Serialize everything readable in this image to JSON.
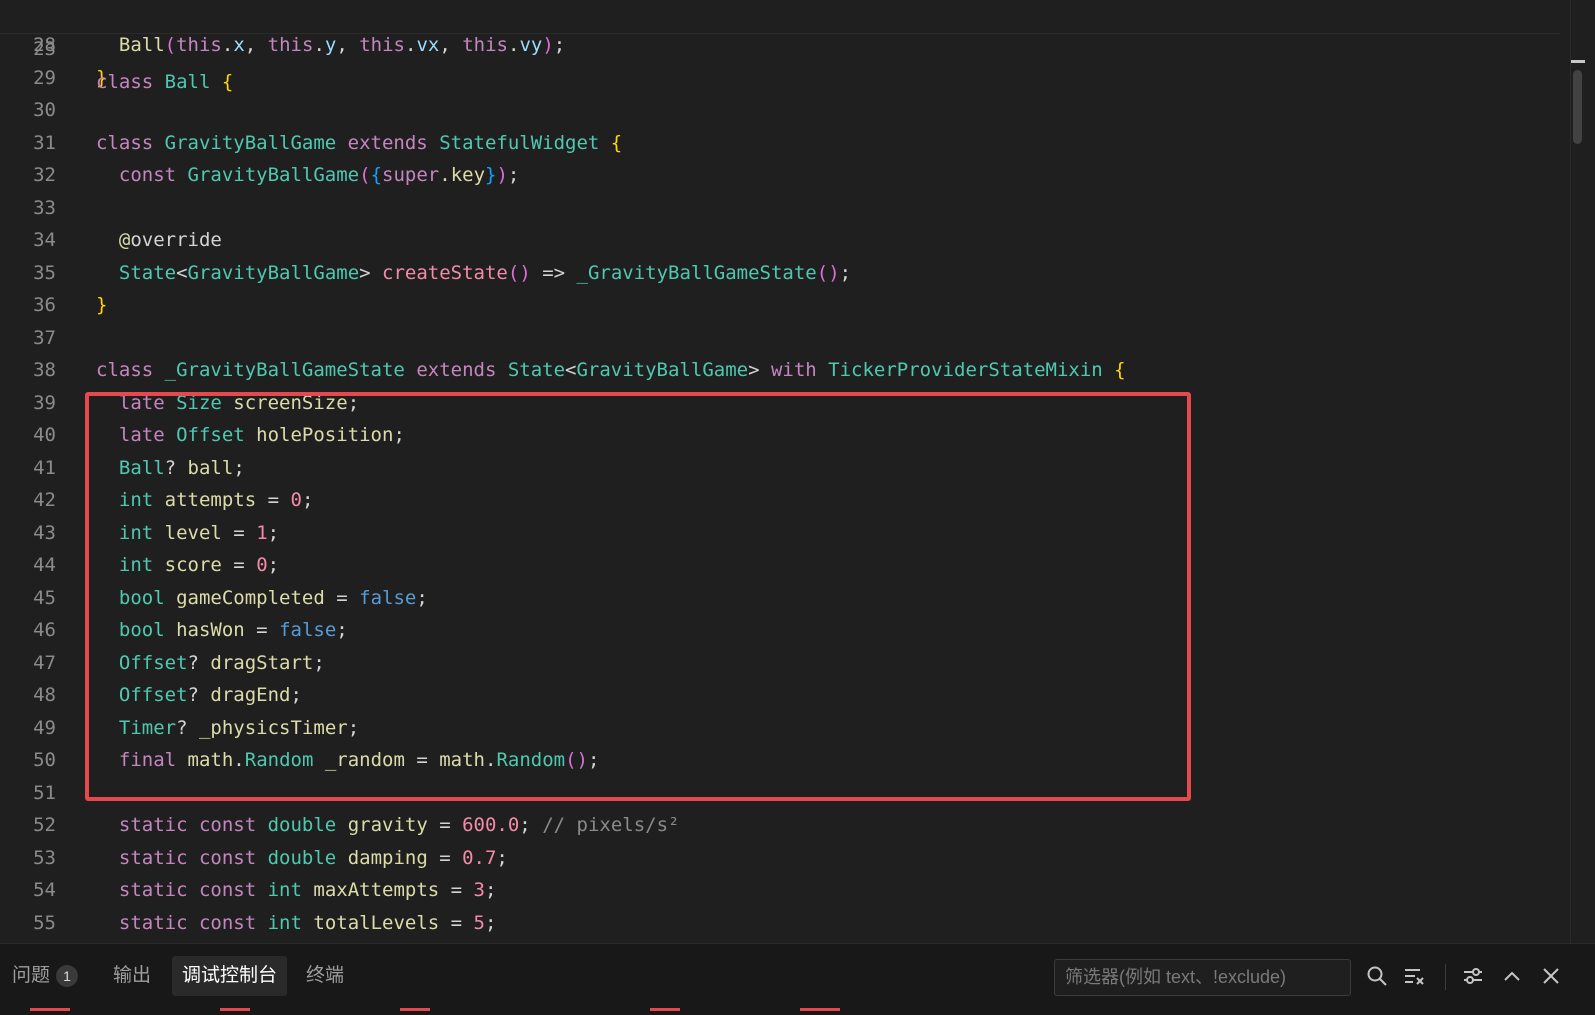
{
  "editor": {
    "sticky": {
      "num": "23",
      "tokens": [
        [
          "kw",
          "class "
        ],
        [
          "ty",
          "Ball "
        ],
        [
          "br1",
          "{"
        ]
      ]
    },
    "lines": [
      {
        "num": "28",
        "tokens": [
          [
            "op",
            "  "
          ],
          [
            "fn",
            "Ball"
          ],
          [
            "br2",
            "("
          ],
          [
            "kw",
            "this"
          ],
          [
            "op",
            "."
          ],
          [
            "vr",
            "x"
          ],
          [
            "op",
            ", "
          ],
          [
            "kw",
            "this"
          ],
          [
            "op",
            "."
          ],
          [
            "vr",
            "y"
          ],
          [
            "op",
            ", "
          ],
          [
            "kw",
            "this"
          ],
          [
            "op",
            "."
          ],
          [
            "vr",
            "vx"
          ],
          [
            "op",
            ", "
          ],
          [
            "kw",
            "this"
          ],
          [
            "op",
            "."
          ],
          [
            "vr",
            "vy"
          ],
          [
            "br2",
            ")"
          ],
          [
            "op",
            ";"
          ]
        ]
      },
      {
        "num": "29",
        "tokens": [
          [
            "cl",
            "}"
          ]
        ]
      },
      {
        "num": "30",
        "tokens": []
      },
      {
        "num": "31",
        "tokens": [
          [
            "kw",
            "class "
          ],
          [
            "ty",
            "GravityBallGame "
          ],
          [
            "kw",
            "extends "
          ],
          [
            "ty",
            "StatefulWidget "
          ],
          [
            "br1",
            "{"
          ]
        ]
      },
      {
        "num": "32",
        "tokens": [
          [
            "op",
            "  "
          ],
          [
            "kw",
            "const "
          ],
          [
            "ty",
            "GravityBallGame"
          ],
          [
            "br2",
            "("
          ],
          [
            "br3",
            "{"
          ],
          [
            "kw",
            "super"
          ],
          [
            "op",
            "."
          ],
          [
            "fn",
            "key"
          ],
          [
            "br3",
            "}"
          ],
          [
            "br2",
            ")"
          ],
          [
            "op",
            ";"
          ]
        ]
      },
      {
        "num": "33",
        "tokens": []
      },
      {
        "num": "34",
        "tokens": [
          [
            "op",
            "  "
          ],
          [
            "an",
            "@"
          ],
          [
            "op",
            "override"
          ]
        ]
      },
      {
        "num": "35",
        "tokens": [
          [
            "op",
            "  "
          ],
          [
            "ty",
            "State"
          ],
          [
            "op",
            "<"
          ],
          [
            "ty",
            "GravityBallGame"
          ],
          [
            "op",
            "> "
          ],
          [
            "nm",
            "createState"
          ],
          [
            "br2",
            "()"
          ],
          [
            "op",
            " => "
          ],
          [
            "ty",
            "_GravityBallGameState"
          ],
          [
            "br2",
            "()"
          ],
          [
            "op",
            ";"
          ]
        ]
      },
      {
        "num": "36",
        "tokens": [
          [
            "br1",
            "}"
          ]
        ]
      },
      {
        "num": "37",
        "tokens": []
      },
      {
        "num": "38",
        "tokens": [
          [
            "kw",
            "class "
          ],
          [
            "ty",
            "_GravityBallGameState "
          ],
          [
            "kw",
            "extends "
          ],
          [
            "ty",
            "State"
          ],
          [
            "op",
            "<"
          ],
          [
            "ty",
            "GravityBallGame"
          ],
          [
            "op",
            "> "
          ],
          [
            "kw",
            "with "
          ],
          [
            "ty",
            "TickerProviderStateMixin "
          ],
          [
            "br1",
            "{"
          ]
        ]
      },
      {
        "num": "39",
        "tokens": [
          [
            "op",
            "  "
          ],
          [
            "kw",
            "late "
          ],
          [
            "ty",
            "Size "
          ],
          [
            "fn",
            "screenSize"
          ],
          [
            "op",
            ";"
          ]
        ]
      },
      {
        "num": "40",
        "tokens": [
          [
            "op",
            "  "
          ],
          [
            "kw",
            "late "
          ],
          [
            "ty",
            "Offset "
          ],
          [
            "fn",
            "holePosition"
          ],
          [
            "op",
            ";"
          ]
        ]
      },
      {
        "num": "41",
        "tokens": [
          [
            "op",
            "  "
          ],
          [
            "ty",
            "Ball"
          ],
          [
            "op",
            "? "
          ],
          [
            "fn",
            "ball"
          ],
          [
            "op",
            ";"
          ]
        ]
      },
      {
        "num": "42",
        "tokens": [
          [
            "op",
            "  "
          ],
          [
            "ty",
            "int "
          ],
          [
            "fn",
            "attempts"
          ],
          [
            "op",
            " = "
          ],
          [
            "nm",
            "0"
          ],
          [
            "op",
            ";"
          ]
        ]
      },
      {
        "num": "43",
        "tokens": [
          [
            "op",
            "  "
          ],
          [
            "ty",
            "int "
          ],
          [
            "fn",
            "level"
          ],
          [
            "op",
            " = "
          ],
          [
            "nm",
            "1"
          ],
          [
            "op",
            ";"
          ]
        ]
      },
      {
        "num": "44",
        "tokens": [
          [
            "op",
            "  "
          ],
          [
            "ty",
            "int "
          ],
          [
            "fn",
            "score"
          ],
          [
            "op",
            " = "
          ],
          [
            "nm",
            "0"
          ],
          [
            "op",
            ";"
          ]
        ]
      },
      {
        "num": "45",
        "tokens": [
          [
            "op",
            "  "
          ],
          [
            "ty",
            "bool "
          ],
          [
            "fn",
            "gameCompleted"
          ],
          [
            "op",
            " = "
          ],
          [
            "bl",
            "false"
          ],
          [
            "op",
            ";"
          ]
        ]
      },
      {
        "num": "46",
        "tokens": [
          [
            "op",
            "  "
          ],
          [
            "ty",
            "bool "
          ],
          [
            "fn",
            "hasWon"
          ],
          [
            "op",
            " = "
          ],
          [
            "bl",
            "false"
          ],
          [
            "op",
            ";"
          ]
        ]
      },
      {
        "num": "47",
        "tokens": [
          [
            "op",
            "  "
          ],
          [
            "ty",
            "Offset"
          ],
          [
            "op",
            "? "
          ],
          [
            "fn",
            "dragStart"
          ],
          [
            "op",
            ";"
          ]
        ]
      },
      {
        "num": "48",
        "tokens": [
          [
            "op",
            "  "
          ],
          [
            "ty",
            "Offset"
          ],
          [
            "op",
            "? "
          ],
          [
            "fn",
            "dragEnd"
          ],
          [
            "op",
            ";"
          ]
        ]
      },
      {
        "num": "49",
        "tokens": [
          [
            "op",
            "  "
          ],
          [
            "ty",
            "Timer"
          ],
          [
            "op",
            "? "
          ],
          [
            "fn",
            "_physicsTimer"
          ],
          [
            "op",
            ";"
          ]
        ]
      },
      {
        "num": "50",
        "tokens": [
          [
            "op",
            "  "
          ],
          [
            "kw",
            "final "
          ],
          [
            "fn",
            "math"
          ],
          [
            "op",
            "."
          ],
          [
            "ty",
            "Random "
          ],
          [
            "fn",
            "_random"
          ],
          [
            "op",
            " = "
          ],
          [
            "fn",
            "math"
          ],
          [
            "op",
            "."
          ],
          [
            "ty",
            "Random"
          ],
          [
            "br2",
            "()"
          ],
          [
            "op",
            ";"
          ]
        ]
      },
      {
        "num": "51",
        "tokens": []
      },
      {
        "num": "52",
        "tokens": [
          [
            "op",
            "  "
          ],
          [
            "kw",
            "static const "
          ],
          [
            "ty",
            "double "
          ],
          [
            "fn",
            "gravity"
          ],
          [
            "op",
            " = "
          ],
          [
            "nm",
            "600.0"
          ],
          [
            "op",
            "; "
          ],
          [
            "cm",
            "// pixels/s²"
          ]
        ]
      },
      {
        "num": "53",
        "tokens": [
          [
            "op",
            "  "
          ],
          [
            "kw",
            "static const "
          ],
          [
            "ty",
            "double "
          ],
          [
            "fn",
            "damping"
          ],
          [
            "op",
            " = "
          ],
          [
            "nm",
            "0.7"
          ],
          [
            "op",
            ";"
          ]
        ]
      },
      {
        "num": "54",
        "tokens": [
          [
            "op",
            "  "
          ],
          [
            "kw",
            "static const "
          ],
          [
            "ty",
            "int "
          ],
          [
            "fn",
            "maxAttempts"
          ],
          [
            "op",
            " = "
          ],
          [
            "nm",
            "3"
          ],
          [
            "op",
            ";"
          ]
        ]
      },
      {
        "num": "55",
        "tokens": [
          [
            "op",
            "  "
          ],
          [
            "kw",
            "static const "
          ],
          [
            "ty",
            "int "
          ],
          [
            "fn",
            "totalLevels"
          ],
          [
            "op",
            " = "
          ],
          [
            "nm",
            "5"
          ],
          [
            "op",
            ";"
          ]
        ]
      }
    ]
  },
  "panel": {
    "tabs": [
      {
        "label": "问题",
        "badge": "1",
        "active": false
      },
      {
        "label": "输出",
        "active": false
      },
      {
        "label": "调试控制台",
        "active": true
      },
      {
        "label": "终端",
        "active": false
      }
    ],
    "filter_placeholder": "筛选器(例如 text、!exclude)"
  },
  "colors": {
    "highlight_box": "#e5484d",
    "background": "#1f1f1f",
    "panel": "#181818"
  }
}
